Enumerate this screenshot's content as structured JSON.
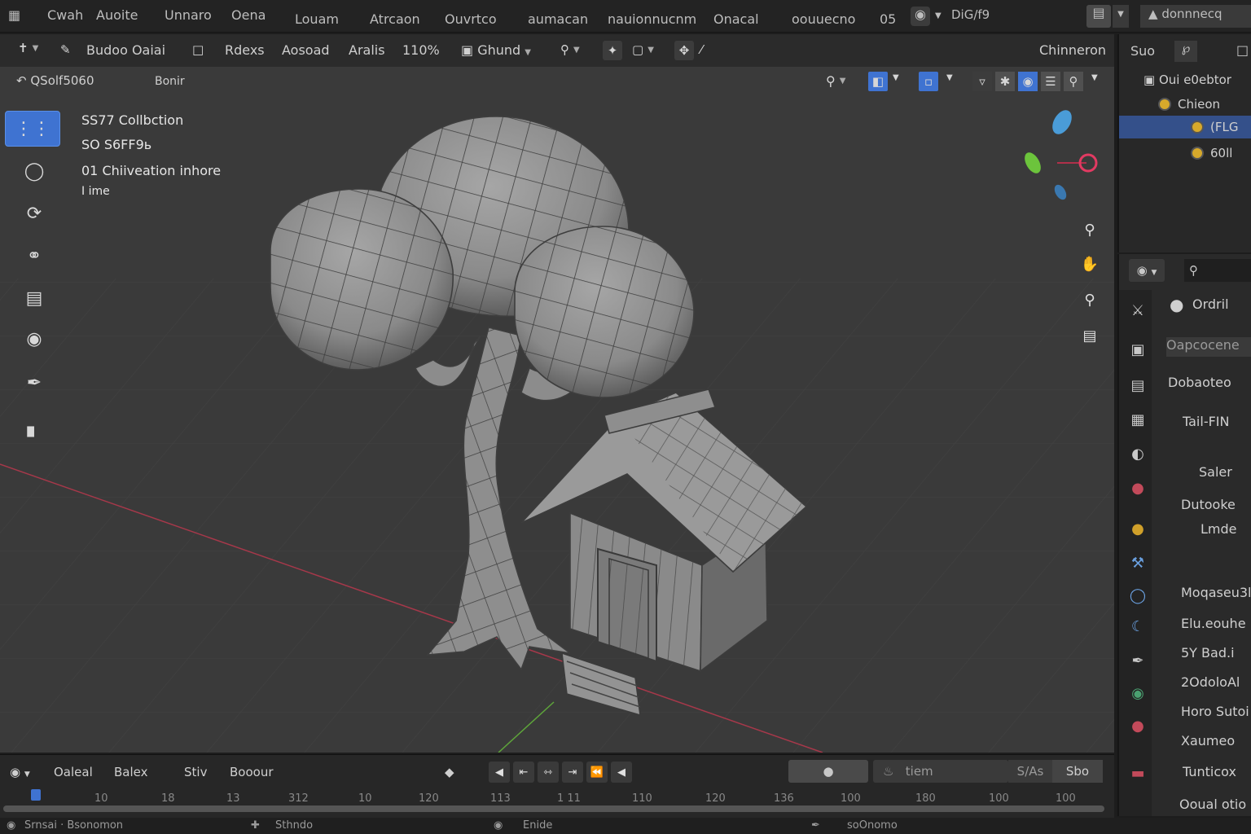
{
  "menubar": {
    "items": [
      "Cwah",
      "Auoite",
      "Unnaro",
      "Oena",
      "Louam",
      "Atrcaon",
      "Ouvrtco",
      "aumacan",
      "nauionnucnm",
      "Onacal",
      "oouuecno",
      "05"
    ],
    "scene_label": "DiG/f9",
    "workspace_label": "donnnecq"
  },
  "toolbar": {
    "mode_label": "Budoo Oaiai",
    "view_label": "Rdexs",
    "select_label": "Aosoad",
    "add_label": "Aralis",
    "zoom_label": "110%",
    "shading_label": "Ghund",
    "right_label": "Chinneron"
  },
  "header2": {
    "object_label": "QSolf5060",
    "submenu_label": "Bonir"
  },
  "viewport": {
    "overlay": {
      "line1": "SS77 Collbction",
      "line2": "SO S6FF9ь",
      "line3": "01  Chiiveation inhore",
      "line4": "I ime"
    },
    "tools": [
      "move-tool",
      "rotate-tool",
      "scale-tool",
      "transform-tool",
      "annotate-tool",
      "measure-tool",
      "cursor-tool",
      "add-cube-tool"
    ],
    "colors": {
      "background": "#3a3a3a",
      "mesh_light": "#9a9a9a",
      "mesh_dark": "#5a5a5a",
      "x_axis": "#b03a4a",
      "y_axis": "#6ab03a",
      "active_blue": "#3f73d1"
    }
  },
  "outliner": {
    "header_label": "Suo",
    "root_label": "Oui e0ebtor",
    "items": [
      {
        "label": "Chieon",
        "selected": false
      },
      {
        "label": "(FLG",
        "selected": true
      },
      {
        "label": "60ll",
        "selected": false
      }
    ]
  },
  "properties": {
    "object_label": "Ordril",
    "section_label": "Oapcocene",
    "rows": [
      "Dobaoteo",
      "Tail-FIN",
      "Saler",
      "Dutooke",
      "Lmde",
      "Moqaseu3l",
      "Elu.eouhe",
      "5Y Bad.i",
      "2OdoloAl",
      "Horo Sutoi",
      "Xaumeo",
      "Tunticox",
      "Ooual otio"
    ]
  },
  "timeline": {
    "labels": [
      "Oaleal",
      "Balex",
      "Stiv",
      "Booour"
    ],
    "range_label_1": "tiem",
    "range_label_2": "S/As",
    "range_label_3": "Sbo",
    "frames": [
      "10",
      "18",
      "13",
      "312",
      "10",
      "120",
      "113",
      "1 11",
      "110",
      "120",
      "136",
      "100",
      "180",
      "100",
      "100"
    ]
  },
  "statusbar": {
    "left": "Srnsai · Bsonomon",
    "mid1": "Sthndo",
    "mid2": "Enide",
    "right": "soOnomo"
  }
}
